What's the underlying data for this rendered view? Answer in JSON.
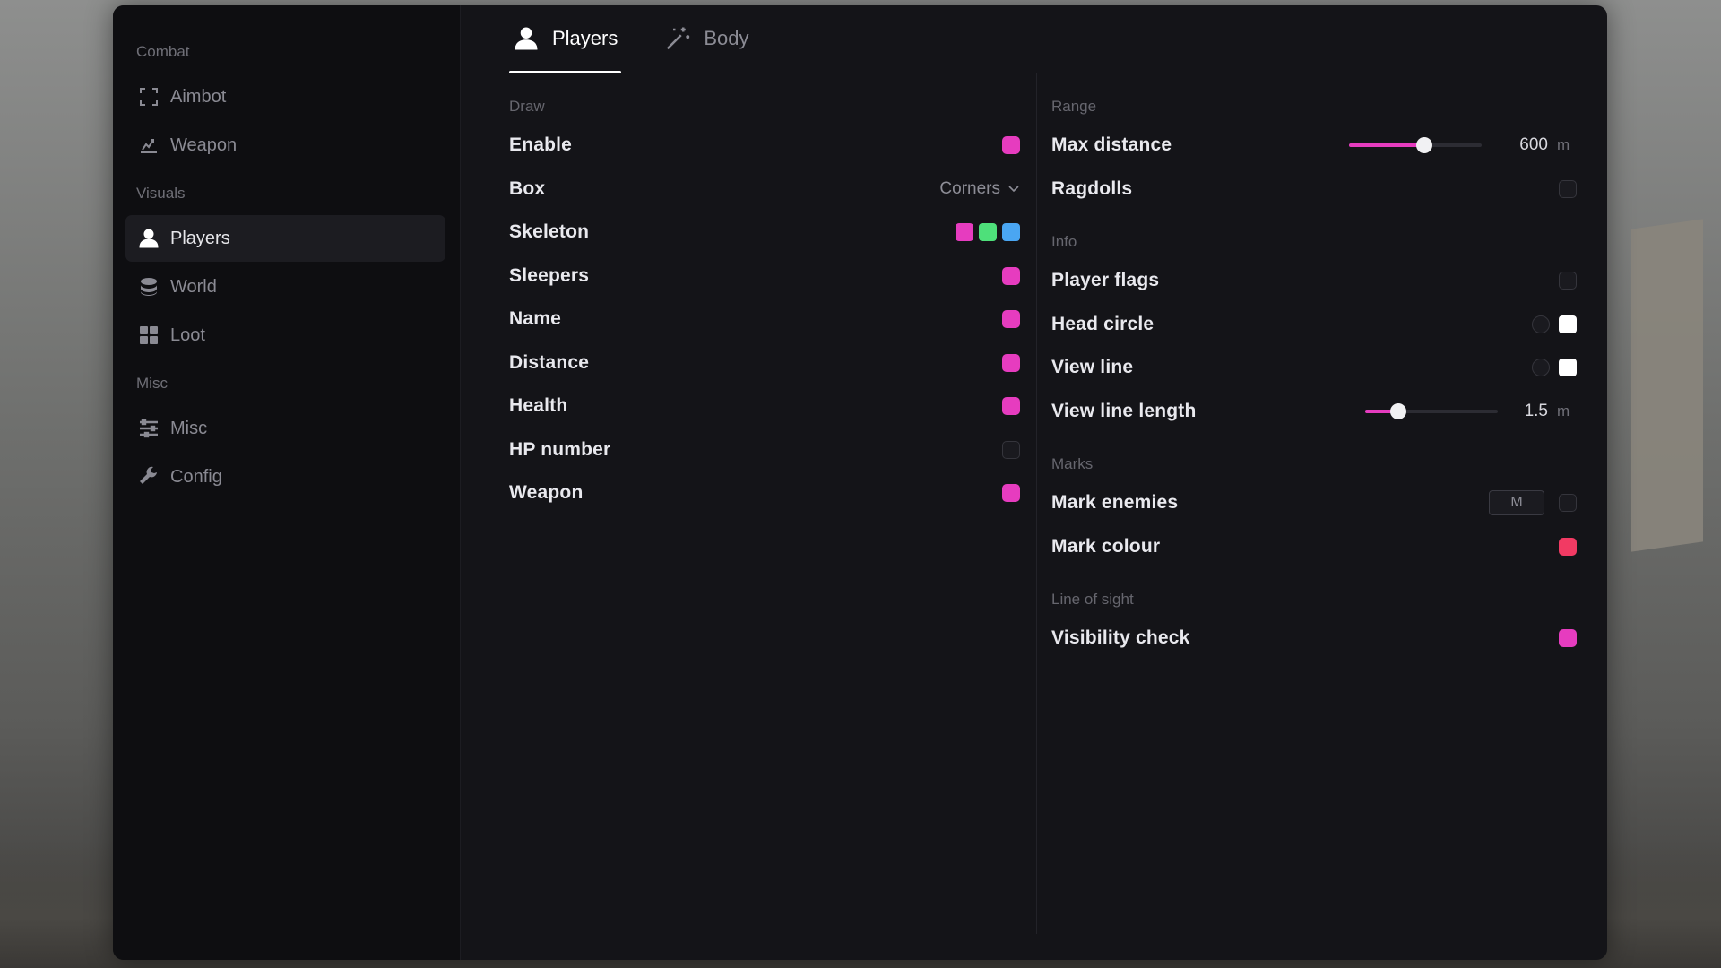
{
  "sidebar": {
    "sections": [
      {
        "title": "Combat",
        "items": [
          {
            "label": "Aimbot",
            "icon": "crosshair-frame-icon",
            "active": false
          },
          {
            "label": "Weapon",
            "icon": "weapon-icon",
            "active": false
          }
        ]
      },
      {
        "title": "Visuals",
        "items": [
          {
            "label": "Players",
            "icon": "person-icon",
            "active": true
          },
          {
            "label": "World",
            "icon": "world-icon",
            "active": false
          },
          {
            "label": "Loot",
            "icon": "grid-icon",
            "active": false
          }
        ]
      },
      {
        "title": "Misc",
        "items": [
          {
            "label": "Misc",
            "icon": "sliders-icon",
            "active": false
          },
          {
            "label": "Config",
            "icon": "wrench-icon",
            "active": false
          }
        ]
      }
    ]
  },
  "tabs": [
    {
      "label": "Players",
      "icon": "person-icon",
      "active": true
    },
    {
      "label": "Body",
      "icon": "magic-wand-icon",
      "active": false
    }
  ],
  "left": {
    "group": "Draw",
    "rows": {
      "enable": {
        "label": "Enable",
        "checked": true
      },
      "box": {
        "label": "Box",
        "value": "Corners"
      },
      "skeleton": {
        "label": "Skeleton",
        "colors": [
          "#e63cbf",
          "#4ee07a",
          "#4aa6f2"
        ]
      },
      "sleepers": {
        "label": "Sleepers",
        "checked": true
      },
      "name": {
        "label": "Name",
        "checked": true
      },
      "distance": {
        "label": "Distance",
        "checked": true
      },
      "health": {
        "label": "Health",
        "checked": true
      },
      "hp_number": {
        "label": "HP number",
        "checked": false
      },
      "weapon": {
        "label": "Weapon",
        "checked": true
      }
    }
  },
  "right": {
    "range": {
      "title": "Range",
      "max_distance": {
        "label": "Max distance",
        "value": "600",
        "unit": "m",
        "fraction": 0.57
      },
      "ragdolls": {
        "label": "Ragdolls",
        "checked": false
      }
    },
    "info": {
      "title": "Info",
      "player_flags": {
        "label": "Player flags",
        "checked": false
      },
      "head_circle": {
        "label": "Head circle",
        "toggle": false,
        "color": "#ffffff"
      },
      "view_line": {
        "label": "View line",
        "toggle": false,
        "color": "#ffffff"
      },
      "view_line_length": {
        "label": "View line length",
        "value": "1.5",
        "unit": "m",
        "fraction": 0.25
      }
    },
    "marks": {
      "title": "Marks",
      "mark_enemies": {
        "label": "Mark enemies",
        "key": "M",
        "checked": false
      },
      "mark_colour": {
        "label": "Mark colour",
        "color": "#f23a63"
      }
    },
    "los": {
      "title": "Line of sight",
      "visibility_check": {
        "label": "Visibility check",
        "checked": true
      }
    }
  },
  "colors": {
    "accent": "#e63cbf",
    "mark": "#f23a63"
  }
}
